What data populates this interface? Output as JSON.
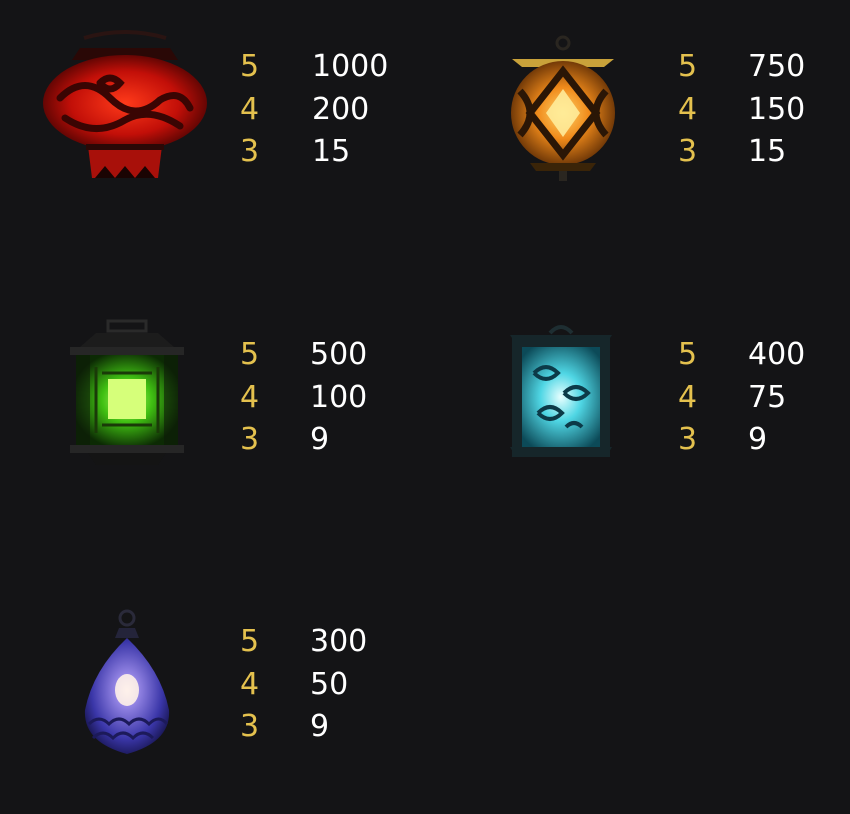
{
  "paytable": {
    "symbols": [
      {
        "icon": "red-dragon-lantern-icon",
        "color": "#c8150c",
        "payouts": [
          {
            "count": "5",
            "amount": "1000"
          },
          {
            "count": "4",
            "amount": "200"
          },
          {
            "count": "3",
            "amount": "15"
          }
        ]
      },
      {
        "icon": "orange-lantern-icon",
        "color": "#f08a1a",
        "payouts": [
          {
            "count": "5",
            "amount": "750"
          },
          {
            "count": "4",
            "amount": "150"
          },
          {
            "count": "3",
            "amount": "15"
          }
        ]
      },
      {
        "icon": "green-lantern-icon",
        "color": "#4fd21c",
        "payouts": [
          {
            "count": "5",
            "amount": "500"
          },
          {
            "count": "4",
            "amount": "100"
          },
          {
            "count": "3",
            "amount": "9"
          }
        ]
      },
      {
        "icon": "cyan-lantern-icon",
        "color": "#39c9d8",
        "payouts": [
          {
            "count": "5",
            "amount": "400"
          },
          {
            "count": "4",
            "amount": "75"
          },
          {
            "count": "3",
            "amount": "9"
          }
        ]
      },
      {
        "icon": "purple-lantern-icon",
        "color": "#4a46b8",
        "payouts": [
          {
            "count": "5",
            "amount": "300"
          },
          {
            "count": "4",
            "amount": "50"
          },
          {
            "count": "3",
            "amount": "9"
          }
        ]
      }
    ],
    "colors": {
      "background": "#141416",
      "count_text": "#e4c14e",
      "amount_text": "#ffffff"
    }
  }
}
